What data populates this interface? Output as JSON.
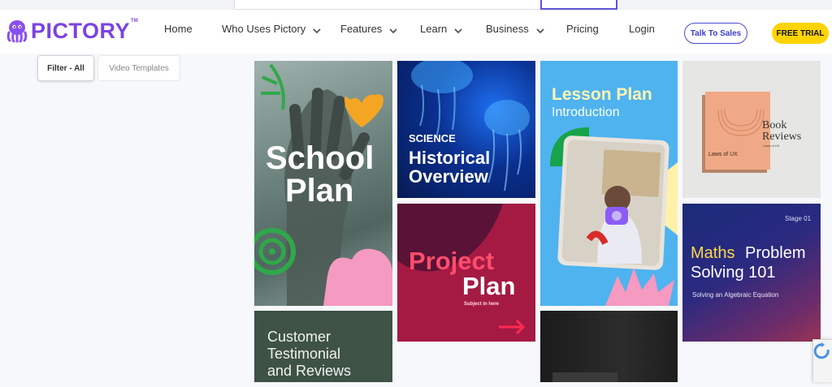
{
  "brand": {
    "name": "PICTORY",
    "tm": "TM"
  },
  "nav": {
    "items": [
      {
        "label": "Home",
        "has_dropdown": false
      },
      {
        "label": "Who Uses Pictory",
        "has_dropdown": true
      },
      {
        "label": "Features",
        "has_dropdown": true
      },
      {
        "label": "Learn",
        "has_dropdown": true
      },
      {
        "label": "Business",
        "has_dropdown": true
      },
      {
        "label": "Pricing",
        "has_dropdown": false
      },
      {
        "label": "Login",
        "has_dropdown": false
      }
    ],
    "talk_to_sales": "Talk To Sales",
    "free_trial": "FREE TRIAL"
  },
  "filters": {
    "all": "Filter - All",
    "video_templates": "Video Templates"
  },
  "templates": {
    "school": {
      "line1": "School",
      "line2": "Plan"
    },
    "science": {
      "tag": "SCIENCE",
      "line1": "Historical",
      "line2": "Overview"
    },
    "lesson": {
      "line1": "Lesson Plan",
      "line2": "Introduction"
    },
    "book": {
      "line1": "Book",
      "line2": "Reviews",
      "sub": "Laws of UX",
      "cover": "Laws of UX"
    },
    "project": {
      "line1": "Project",
      "line2": "Plan",
      "sub": "Subject in here"
    },
    "maths": {
      "stage": "Stage 01",
      "accent": "Maths",
      "line1": "Problem",
      "line2": "Solving 101",
      "sub": "Solving an Algebraic Equation"
    },
    "customer": {
      "line1": "Customer",
      "line2": "Testimonial",
      "line3": "and Reviews"
    }
  },
  "colors": {
    "brand": "#7a43e0",
    "accent_yellow": "#ffd400",
    "sales_border": "#4b4ad6"
  }
}
